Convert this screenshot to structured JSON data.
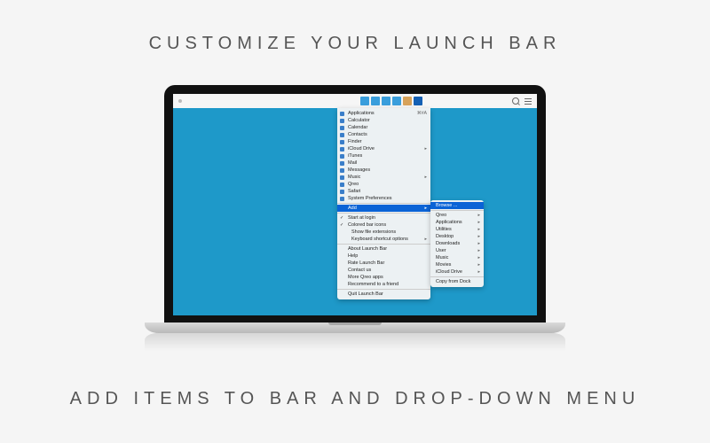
{
  "headline_top": "CUSTOMIZE YOUR LAUNCH BAR",
  "headline_bottom": "ADD ITEMS TO BAR AND DROP-DOWN MENU",
  "bar_icons": [
    {
      "name": "cloud-icon",
      "color": "#3a9edc"
    },
    {
      "name": "folder-icon",
      "color": "#3a9edc"
    },
    {
      "name": "folder-icon",
      "color": "#3a9edc"
    },
    {
      "name": "folder-icon",
      "color": "#3a9edc"
    },
    {
      "name": "home-icon",
      "color": "#d7a25a"
    },
    {
      "name": "app-icon",
      "color": "#1560b4"
    }
  ],
  "dropdown": {
    "section_apps": [
      {
        "label": "Applications",
        "shortcut": "⌘#A",
        "has_arrow": true
      },
      {
        "label": "Calculator"
      },
      {
        "label": "Calendar"
      },
      {
        "label": "Contacts"
      },
      {
        "label": "Finder"
      },
      {
        "label": "iCloud Drive",
        "has_arrow": true
      },
      {
        "label": "iTunes"
      },
      {
        "label": "Mail"
      },
      {
        "label": "Messages"
      },
      {
        "label": "Music",
        "has_arrow": true
      },
      {
        "label": "Qreo"
      },
      {
        "label": "Safari"
      },
      {
        "label": "System Preferences"
      }
    ],
    "add_label": "Add",
    "section_opts": [
      {
        "label": "Start at login",
        "checked": true
      },
      {
        "label": "Colored bar icons",
        "checked": true
      },
      {
        "label": "Show file extensions",
        "indent": true
      },
      {
        "label": "Keyboard shortcut options",
        "indent": true,
        "has_arrow": true
      }
    ],
    "section_about": [
      {
        "label": "About Launch Bar"
      },
      {
        "label": "Help"
      },
      {
        "label": "Rate Launch Bar"
      },
      {
        "label": "Contact us"
      },
      {
        "label": "More Qreo apps"
      },
      {
        "label": "Recommend to a friend"
      }
    ],
    "quit_label": "Quit Launch Bar"
  },
  "submenu": {
    "browse_label": "Browse ...",
    "items": [
      "Qreo",
      "Applications",
      "Utilities",
      "Desktop",
      "Downloads",
      "User",
      "Music",
      "Movies",
      "iCloud Drive",
      "Copy from Dock"
    ]
  }
}
